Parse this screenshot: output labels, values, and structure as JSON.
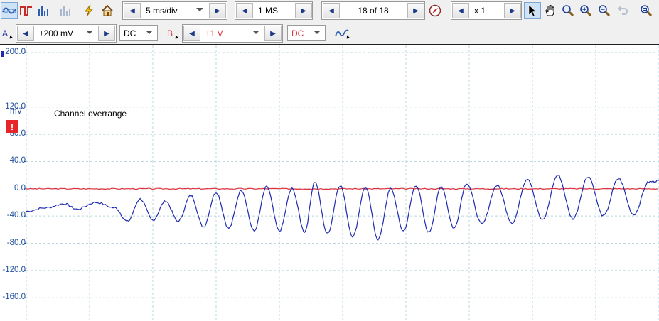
{
  "toolbar": {
    "timebase": "5 ms/div",
    "samples": "1 MS",
    "capture": "18 of 18",
    "zoom": "x 1"
  },
  "channel_a": {
    "letter": "A",
    "range": "±200 mV",
    "coupling": "DC",
    "color": "#1f2bb0"
  },
  "channel_b": {
    "letter": "B",
    "range": "±1 V",
    "coupling": "DC",
    "color": "#e0323c"
  },
  "scope": {
    "unit": "mV",
    "overrange_message": "Channel overrange",
    "overrange_symbol": "!",
    "y_ticks": [
      "200.0",
      "120.0",
      "80.0",
      "40.0",
      "0.0",
      "-40.0",
      "-80.0",
      "-120.0",
      "-160.0"
    ],
    "y_tick_values": [
      200,
      120,
      80,
      40,
      0,
      -40,
      -80,
      -120,
      -160
    ],
    "grid_color": "#b8d8dc",
    "grid_columns": 10
  },
  "chart_data": {
    "type": "line",
    "title": "",
    "xlabel": "",
    "ylabel": "mV",
    "ylim": [
      -190,
      200
    ],
    "x_range": [
      0,
      50
    ],
    "x_unit": "ms",
    "series": [
      {
        "name": "A",
        "color": "#1f2bb0",
        "x": [
          0,
          1.5,
          3,
          4,
          5.5,
          7,
          8,
          9,
          10,
          11,
          12,
          13,
          14,
          15,
          16,
          17,
          18,
          19,
          20,
          21,
          22,
          22.8,
          23.8,
          24.8,
          25.8,
          26.8,
          27.8,
          28.8,
          29.8,
          30.8,
          31.8,
          32.8,
          33.8,
          34.8,
          36,
          37.2,
          38.4,
          39.6,
          40.8,
          42,
          43.2,
          44.4,
          45.6,
          46.8,
          48,
          49.2,
          50
        ],
        "y": [
          -33,
          -28,
          -22,
          -30,
          -20,
          -28,
          -48,
          -15,
          -46,
          -18,
          -48,
          -10,
          -56,
          -5,
          -58,
          -2,
          -62,
          3,
          -62,
          0,
          -63,
          10,
          -66,
          5,
          -70,
          2,
          -74,
          0,
          -62,
          5,
          -64,
          3,
          -58,
          8,
          -52,
          5,
          -50,
          15,
          -46,
          20,
          -44,
          18,
          -40,
          15,
          -38,
          10,
          12
        ]
      },
      {
        "name": "B",
        "color": "#e0323c",
        "x": [
          0,
          50
        ],
        "y": [
          0,
          0
        ]
      }
    ]
  }
}
